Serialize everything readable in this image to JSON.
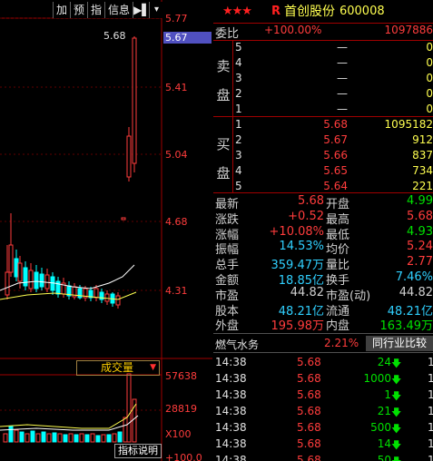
{
  "toolbar": {
    "buttons": [
      "加",
      "预",
      "指",
      "信息"
    ],
    "icon_button": "▶▌",
    "dropdown": "▾"
  },
  "chart": {
    "price_scale": [
      "5.77",
      "5.67",
      "5.41",
      "5.04",
      "4.68",
      "4.31"
    ],
    "current_price_marker": "5.67",
    "peak_label": "5.68",
    "volume_scale": [
      "57638",
      "28819",
      "X100"
    ],
    "volume_bottom_label": "+100.0",
    "volume_selector": "成交量",
    "indicator_button": "指标说明",
    "colors": {
      "up": "#ff3c3c",
      "down": "#00ffff",
      "ma_white": "#ffffff",
      "ma_yellow": "#ffff50",
      "grid": "#a00000"
    }
  },
  "header": {
    "stars": "★★★",
    "badge": "R",
    "stock_name": "首创股份",
    "stock_code": "600008"
  },
  "weibi": {
    "label": "委比",
    "percent": "+100.00%",
    "diff": "1097886"
  },
  "sell": {
    "label": [
      "卖",
      "盘"
    ],
    "rows": [
      {
        "n": "5",
        "p": "—",
        "v": "0"
      },
      {
        "n": "4",
        "p": "—",
        "v": "0"
      },
      {
        "n": "3",
        "p": "—",
        "v": "0"
      },
      {
        "n": "2",
        "p": "—",
        "v": "0"
      },
      {
        "n": "1",
        "p": "—",
        "v": "0"
      }
    ]
  },
  "buy": {
    "label": [
      "买",
      "盘"
    ],
    "rows": [
      {
        "n": "1",
        "p": "5.68",
        "v": "1095182"
      },
      {
        "n": "2",
        "p": "5.67",
        "v": "912"
      },
      {
        "n": "3",
        "p": "5.66",
        "v": "837"
      },
      {
        "n": "4",
        "p": "5.65",
        "v": "734"
      },
      {
        "n": "5",
        "p": "5.64",
        "v": "221"
      }
    ]
  },
  "stats": [
    {
      "k1": "最新",
      "v1": "5.68",
      "k2": "开盘",
      "v2": "4.99"
    },
    {
      "k1": "涨跌",
      "v1": "+0.52",
      "k2": "最高",
      "v2": "5.68"
    },
    {
      "k1": "涨幅",
      "v1": "+10.08%",
      "k2": "最低",
      "v2": "4.93"
    },
    {
      "k1": "振幅",
      "v1": "14.53%",
      "k2": "均价",
      "v2": "5.24"
    },
    {
      "k1": "总手",
      "v1": "359.47万",
      "k2": "量比",
      "v2": "2.77"
    },
    {
      "k1": "金额",
      "v1": "18.85亿",
      "k2": "换手",
      "v2": "7.46%"
    },
    {
      "k1": "市盈",
      "v1": "44.82",
      "k2": "市盈(动)",
      "v2": "44.82"
    },
    {
      "k1": "股本",
      "v1": "48.21亿",
      "k2": "流通",
      "v2": "48.21亿"
    },
    {
      "k1": "外盘",
      "v1": "195.98万",
      "k2": "内盘",
      "v2": "163.49万"
    }
  ],
  "industry": {
    "name": "燃气水务",
    "percent": "2.21%",
    "button": "同行业比较"
  },
  "ticks": [
    {
      "t": "14:38",
      "p": "5.68",
      "v": "24",
      "a": "🡇",
      "c": "1"
    },
    {
      "t": "14:38",
      "p": "5.68",
      "v": "1000",
      "a": "🡇",
      "c": "1"
    },
    {
      "t": "14:38",
      "p": "5.68",
      "v": "1",
      "a": "🡇",
      "c": "1"
    },
    {
      "t": "14:38",
      "p": "5.68",
      "v": "21",
      "a": "🡇",
      "c": "1"
    },
    {
      "t": "14:38",
      "p": "5.68",
      "v": "500",
      "a": "🡇",
      "c": "1"
    },
    {
      "t": "14:38",
      "p": "5.68",
      "v": "14",
      "a": "🡇",
      "c": "1"
    },
    {
      "t": "14:38",
      "p": "5.68",
      "v": "50",
      "a": "🡇",
      "c": "1"
    }
  ]
}
